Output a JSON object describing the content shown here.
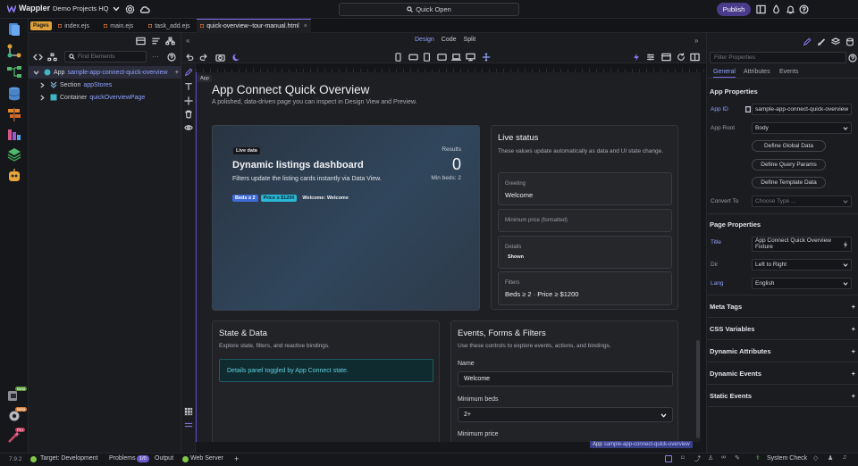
{
  "app": {
    "name": "Wappler",
    "project": "Demo Projects HQ",
    "quick_open": "Quick Open",
    "publish": "Publish"
  },
  "tabs": {
    "pages_badge": "Pages",
    "items": [
      "index.ejs",
      "main.ejs",
      "task_add.ejs",
      "quick-overview--tour-manual.html"
    ]
  },
  "view_modes": {
    "design": "Design",
    "code": "Code",
    "split": "Split"
  },
  "left": {
    "find_placeholder": "Find Elements",
    "tree": [
      {
        "type": "App",
        "name": "sample-app-connect-quick-overview"
      },
      {
        "type": "Section",
        "name": "appStores"
      },
      {
        "type": "Container",
        "name": "quickOverviewPage"
      }
    ],
    "version": "7.9.2"
  },
  "canvas": {
    "app_tag": "App",
    "page_title": "App Connect Quick Overview",
    "page_subtitle": "A polished, data-driven page you can inspect in Design View and Preview.",
    "hero": {
      "badge": "Live data",
      "title": "Dynamic listings dashboard",
      "text": "Filters update the listing cards instantly via Data View.",
      "pills": [
        "Beds ≥ 2",
        "Price ≥ $1200",
        "Welcome: Welcome"
      ],
      "results_label": "Results",
      "results_value": "0",
      "min_beds": "Min beds: 2"
    },
    "live_status": {
      "title": "Live status",
      "text": "These values update automatically as data and UI state change.",
      "items": [
        {
          "label": "Greeting",
          "value": "Welcome"
        },
        {
          "label": "Minimum price (formatted)",
          "value": ""
        },
        {
          "label": "Details",
          "value": "Shown"
        },
        {
          "label": "Filters",
          "value": "Beds ≥ 2 · Price ≥ $1200"
        }
      ]
    },
    "state_data": {
      "title": "State & Data",
      "text": "Explore state, filters, and reactive bindings.",
      "alert": "Details panel toggled by App Connect state."
    },
    "events_forms": {
      "title": "Events, Forms & Filters",
      "text": "Use these controls to explore events, actions, and bindings.",
      "name_label": "Name",
      "name_value": "Welcome",
      "beds_label": "Minimum beds",
      "beds_value": "2+",
      "price_label": "Minimum price"
    },
    "selection_tag": {
      "type": "App",
      "name": "sample-app-connect-quick-overview"
    }
  },
  "right": {
    "filter_placeholder": "Filter Properties",
    "tabs": [
      "General",
      "Attributes",
      "Events"
    ],
    "app_properties": "App Properties",
    "app_id_label": "App ID",
    "app_id_value": "sample-app-connect-quick-overview",
    "app_root_label": "App Root",
    "app_root_value": "Body",
    "buttons": [
      "Define Global Data",
      "Define Query Params",
      "Define Template Data"
    ],
    "convert_to_label": "Convert To",
    "convert_to_placeholder": "Choose Type ...",
    "page_properties": "Page Properties",
    "title_label": "Title",
    "title_value": "App Connect Quick Overview Fixture",
    "dir_label": "Dir",
    "dir_value": "Left to Right",
    "lang_label": "Lang",
    "lang_value": "English",
    "sections": [
      "Meta Tags",
      "CSS Variables",
      "Dynamic Attributes",
      "Dynamic Events",
      "Static Events"
    ]
  },
  "status": {
    "target": "Target: Development",
    "problems": "Problems",
    "problems_count": "1/0",
    "output": "Output",
    "web_server": "Web Server",
    "system_check": "System Check",
    "rail_badges": [
      "Beta",
      "Beta",
      "Pro"
    ]
  },
  "colors": {
    "accent": "#7c6cf0",
    "brand_purple": "#4a3c8a",
    "live_green": "#3cb371",
    "cyan": "#3fb6c8"
  }
}
